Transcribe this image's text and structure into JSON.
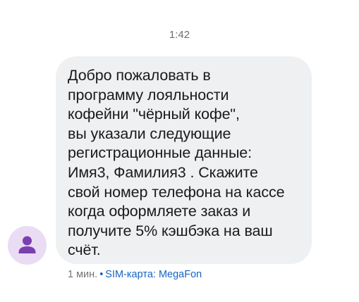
{
  "conversation": {
    "timestamp": "1:42"
  },
  "message": {
    "text": "Добро пожаловать в\nпрограмму лояльности\nкофейни \"чёрный кофе\",\nвы указали следующие\nрегистрационные данные:\nИмя3, Фамилия3 . Скажите\nсвой номер телефона на кассе\nкогда оформляете заказ и\nполучите 5% кэшбэка на ваш\nсчёт.",
    "time_ago": "1 мин.",
    "separator": "•",
    "sim_label": "SIM-карта: MegaFon"
  },
  "sender": {
    "avatar_icon": "person-icon",
    "avatar_bg_color": "#e9dcf3",
    "avatar_icon_color": "#7b3fb0"
  },
  "colors": {
    "bubble": "#eef0f2",
    "accent": "#1565c0",
    "secondary_text": "#757575"
  }
}
